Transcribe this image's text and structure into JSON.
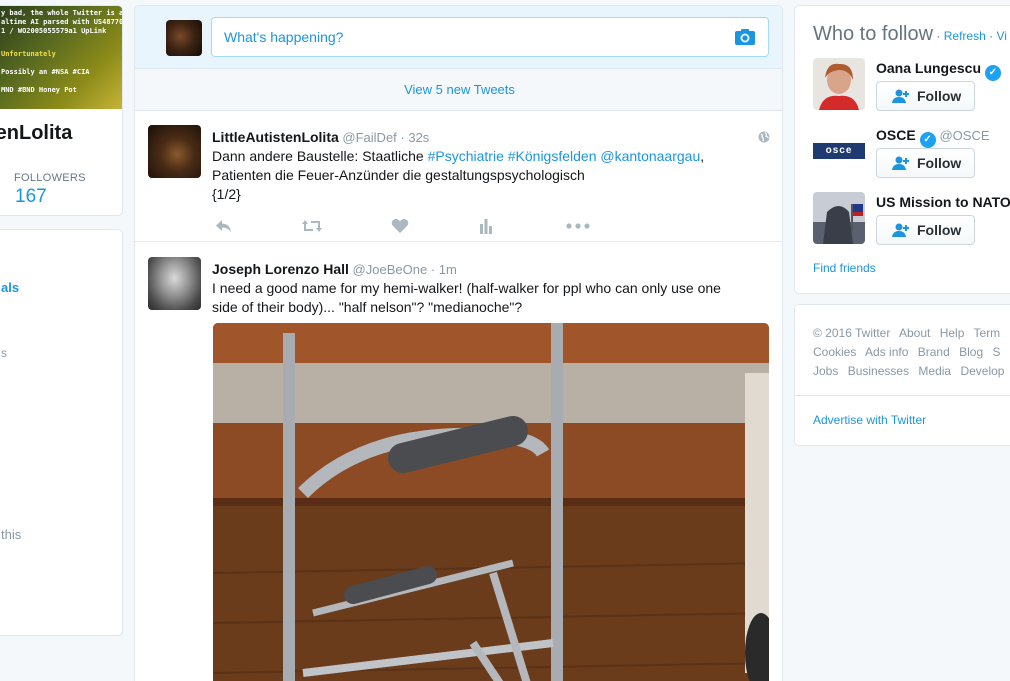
{
  "profile": {
    "banner_lines": [
      "y bad, the whole Twitter is a",
      "altime AI parsed with US4877027",
      "1 / WO2005055579a1 UpLink",
      "Unfortunately",
      "Possibly an #NSA #CIA",
      "MND #BND Honey Pot"
    ],
    "name": "tenLolita",
    "followers_label": "FOLLOWERS",
    "followers_count": "167"
  },
  "trends": {
    "fragments": [
      "als",
      "s",
      "this"
    ]
  },
  "compose": {
    "placeholder": "What's happening?"
  },
  "new_tweets": "View 5 new Tweets",
  "tweets": [
    {
      "name": "LittleAutistenLolita",
      "handle": "@FailDef",
      "time": "· 32s",
      "text_pre": "Dann andere Baustelle: Staatliche ",
      "link1": "#Psychiatrie",
      "link2": "#Königsfelden",
      "link3": "@kantonaargau",
      "text_post1": ",",
      "line2": "Patienten die Feuer-Anzünder die gestaltungspsychologisch",
      "line3": "{1/2}"
    },
    {
      "name": "Joseph Lorenzo Hall",
      "handle": "@JoeBeOne",
      "time": "· 1m",
      "line1": "I need a good name for my hemi-walker! (half-walker for ppl who can only use one",
      "line2": "side of their body)... \"half nelson\"? \"medianoche\"?"
    }
  ],
  "who_to_follow": {
    "title": "Who to follow",
    "sep": " · ",
    "refresh": "Refresh",
    "view_all": "Vi",
    "users": [
      {
        "name": "Oana Lungescu",
        "handle": "",
        "follow": "Follow"
      },
      {
        "name": "OSCE",
        "handle": "@OSCE",
        "follow": "Follow",
        "logo_text": "osce"
      },
      {
        "name": "US Mission to NATO",
        "handle": "",
        "follow": "Follow"
      }
    ],
    "find_friends": "Find friends"
  },
  "footer": {
    "line1": [
      "© 2016 Twitter",
      "About",
      "Help",
      "Term"
    ],
    "line2": [
      "Cookies",
      "Ads info",
      "Brand",
      "Blog",
      "S"
    ],
    "line3": [
      "Jobs",
      "Businesses",
      "Media",
      "Develop"
    ],
    "advertise": "Advertise with Twitter"
  },
  "colors": {
    "link": "#1b95e0",
    "verified": "#1da1f2",
    "compose_bg": "#e8f5fd"
  }
}
